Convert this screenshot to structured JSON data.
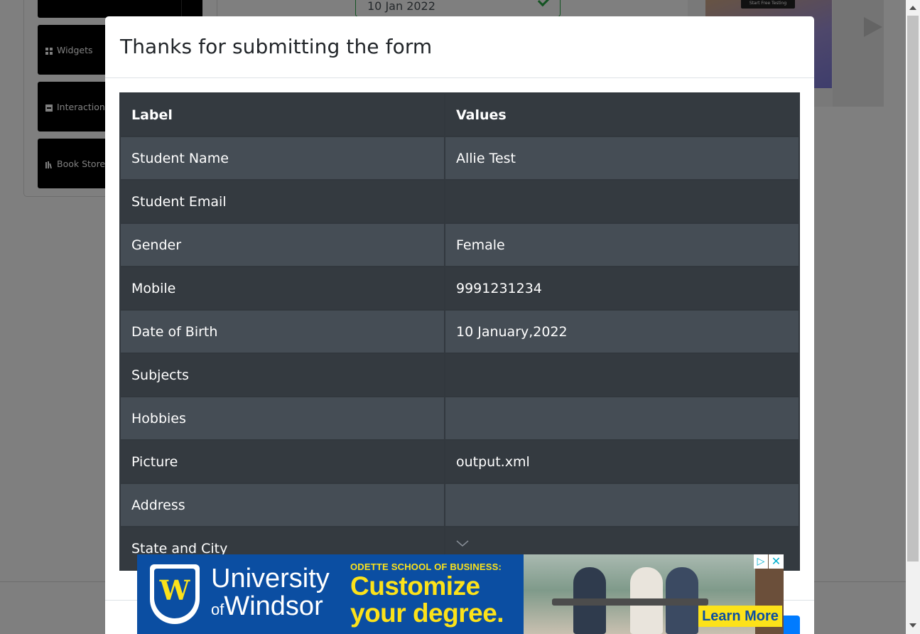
{
  "background": {
    "sidebar": {
      "groups": [
        {
          "label": ""
        },
        {
          "label": "Widgets"
        },
        {
          "label": "Interactions"
        },
        {
          "label": "Book Store A"
        }
      ]
    },
    "date_of_birth_input": {
      "value": "10 Jan 2022"
    },
    "side_ad": {
      "button_label": "Start Free Testing"
    }
  },
  "modal": {
    "title": "Thanks for submitting the form",
    "table": {
      "headers": [
        "Label",
        "Values"
      ],
      "rows": [
        {
          "label": "Student Name",
          "value": "Allie Test"
        },
        {
          "label": "Student Email",
          "value": ""
        },
        {
          "label": "Gender",
          "value": "Female"
        },
        {
          "label": "Mobile",
          "value": "9991231234"
        },
        {
          "label": "Date of Birth",
          "value": "10 January,2022"
        },
        {
          "label": "Subjects",
          "value": ""
        },
        {
          "label": "Hobbies",
          "value": ""
        },
        {
          "label": "Picture",
          "value": "output.xml"
        },
        {
          "label": "Address",
          "value": ""
        },
        {
          "label": "State and City",
          "value": ""
        }
      ]
    }
  },
  "banner_ad": {
    "university_line1": "University",
    "university_line2_prefix": "of",
    "university_line2": "Windsor",
    "school": "ODETTE SCHOOL OF BUSINESS:",
    "headline_line1": "Customize",
    "headline_line2": "your degree.",
    "cta": "Learn More",
    "shield_letter": "W",
    "adchoices_icon": "▷",
    "close_icon": "✕"
  },
  "colors": {
    "table_dark": "#343a40",
    "table_stripe": "#454d55",
    "success_green": "#28a745",
    "banner_blue": "#0b4ea2",
    "banner_yellow": "#fce21a"
  }
}
